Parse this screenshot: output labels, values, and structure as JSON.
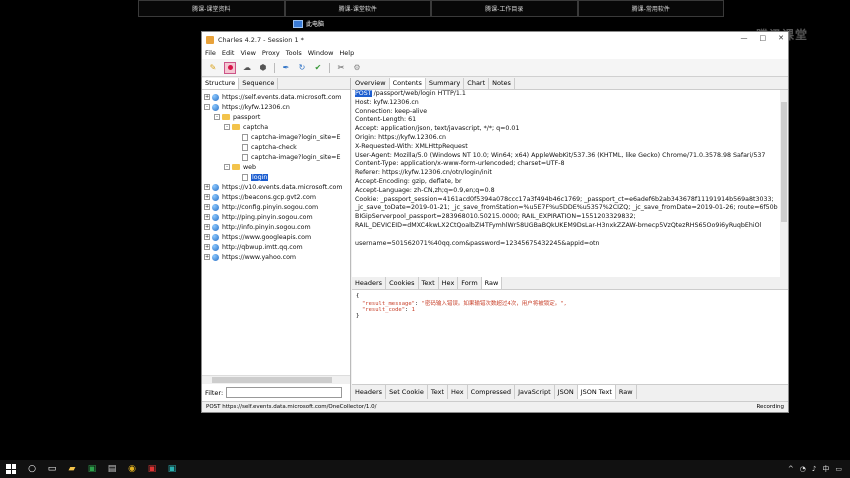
{
  "top_tabs": [
    "腾课-课堂资料",
    "腾课-课堂软件",
    "腾课-工作目录",
    "腾课-常用软件"
  ],
  "desktop_icon": "此电脑",
  "watermark": "腾讯课堂",
  "window": {
    "title": "Charles 4.2.7 - Session 1 *",
    "min": "—",
    "max": "□",
    "close": "✕"
  },
  "menu": [
    "File",
    "Edit",
    "View",
    "Proxy",
    "Tools",
    "Window",
    "Help"
  ],
  "left_tabs": [
    "Structure",
    "Sequence"
  ],
  "tree": [
    {
      "level": 0,
      "type": "host",
      "expand": "+",
      "label": "https://self.events.data.microsoft.com"
    },
    {
      "level": 0,
      "type": "host",
      "expand": "-",
      "label": "https://kyfw.12306.cn"
    },
    {
      "level": 1,
      "type": "folder",
      "expand": "-",
      "label": "passport"
    },
    {
      "level": 2,
      "type": "folder",
      "expand": "-",
      "label": "captcha"
    },
    {
      "level": 3,
      "type": "doc",
      "expand": "",
      "label": "captcha-image?login_site=E"
    },
    {
      "level": 3,
      "type": "doc",
      "expand": "",
      "label": "captcha-check"
    },
    {
      "level": 3,
      "type": "doc",
      "expand": "",
      "label": "captcha-image?login_site=E"
    },
    {
      "level": 2,
      "type": "folder",
      "expand": "-",
      "label": "web"
    },
    {
      "level": 3,
      "type": "doc",
      "expand": "",
      "label": "login",
      "selected": true
    },
    {
      "level": 0,
      "type": "host",
      "expand": "+",
      "label": "https://v10.events.data.microsoft.com"
    },
    {
      "level": 0,
      "type": "host",
      "expand": "+",
      "label": "https://beacons.gcp.gvt2.com"
    },
    {
      "level": 0,
      "type": "host",
      "expand": "+",
      "label": "http://config.pinyin.sogou.com"
    },
    {
      "level": 0,
      "type": "host",
      "expand": "+",
      "label": "http://ping.pinyin.sogou.com"
    },
    {
      "level": 0,
      "type": "host",
      "expand": "+",
      "label": "http://info.pinyin.sogou.com"
    },
    {
      "level": 0,
      "type": "host",
      "expand": "+",
      "label": "https://www.googleapis.com"
    },
    {
      "level": 0,
      "type": "host",
      "expand": "+",
      "label": "http://qbwup.imtt.qq.com"
    },
    {
      "level": 0,
      "type": "host",
      "expand": "+",
      "label": "https://www.yahoo.com"
    }
  ],
  "filter_label": "Filter:",
  "right_tabs": [
    "Overview",
    "Contents",
    "Summary",
    "Chart",
    "Notes"
  ],
  "request": {
    "method": "POST",
    "first_line_rest": " /passport/web/login HTTP/1.1",
    "headers": [
      "Host: kyfw.12306.cn",
      "Connection: keep-alive",
      "Content-Length: 61",
      "Accept: application/json, text/javascript, */*; q=0.01",
      "Origin: https://kyfw.12306.cn",
      "X-Requested-With: XMLHttpRequest",
      "User-Agent: Mozilla/5.0 (Windows NT 10.0; Win64; x64) AppleWebKit/537.36 (KHTML, like Gecko) Chrome/71.0.3578.98 Safari/537",
      "Content-Type: application/x-www-form-urlencoded; charset=UTF-8",
      "Referer: https://kyfw.12306.cn/otn/login/init",
      "Accept-Encoding: gzip, deflate, br",
      "Accept-Language: zh-CN,zh;q=0.9,en;q=0.8",
      "Cookie: _passport_session=4161acd0f5394a078ccc17a3f494b46c1769; _passport_ct=e6adef6b2ab343678f11191914b569a8t3033;",
      "_jc_save_toDate=2019-01-21; _jc_save_fromStation=%u5E7F%u5DDE%u5357%2CIZQ; _jc_save_fromDate=2019-01-26; route=6f50b",
      "BIGipServerpool_passport=283968010.50215.0000; RAIL_EXPIRATION=1551203329832;",
      "RAIL_DEVICEID=dMXC4kwLX2CtQoalbZI4TFymhlWr58UGBaBQkUKEM9DsLar-H3nxkZZAW-bmecp5VzQtezRHS65Oo9i6yRuqbEhiOl"
    ],
    "body": "username=501562071%40qq.com&password=12345675432245&appid=otn"
  },
  "body_tabs": [
    "Headers",
    "Cookies",
    "Text",
    "Hex",
    "Form",
    "Raw"
  ],
  "response": {
    "open": "{",
    "line1_key": "\"result_message\"",
    "line1_val": "\"密码输入错误。如果输错次数超过4次，用户将被锁定。\",",
    "line2_key": "\"result_code\"",
    "line2_val": "1",
    "close": "}"
  },
  "resp_tabs": [
    "Headers",
    "Set Cookie",
    "Text",
    "Hex",
    "Compressed",
    "JavaScript",
    "JSON",
    "JSON Text",
    "Raw"
  ],
  "status": {
    "url": "POST https://self.events.data.microsoft.com/OneCollector/1.0/",
    "state": "Recording"
  },
  "tray": {
    "lang": "中",
    "arrow": "^"
  }
}
